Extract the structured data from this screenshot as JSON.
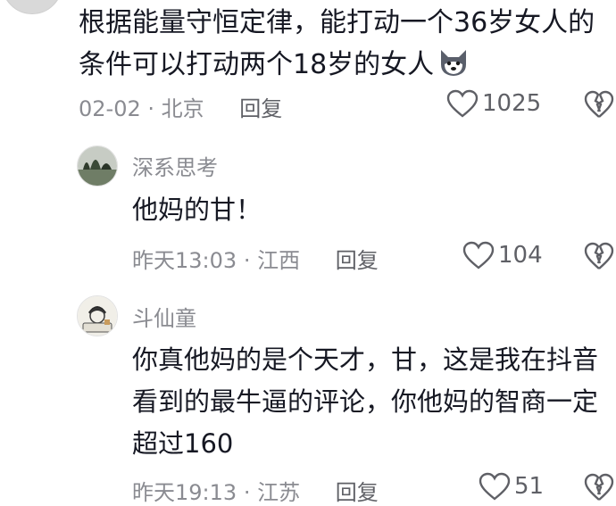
{
  "comment": {
    "text": "根据能量守恒定律，能打动一个36岁女人的条件可以打动两个18岁的女人",
    "date": "02-02",
    "location": "北京",
    "reply_label": "回复",
    "likes": "1025",
    "emoji_icon": "wolf-emoji-icon"
  },
  "replies": [
    {
      "name": "深系思考",
      "text": "他妈的甘！",
      "date": "昨天13:03",
      "location": "江西",
      "reply_label": "回复",
      "likes": "104"
    },
    {
      "name": "斗仙童",
      "text": "你真他妈的是个天才，甘，这是我在抖音看到的最牛逼的评论，你他妈的智商一定超过160",
      "date": "昨天19:13",
      "location": "江苏",
      "reply_label": "回复",
      "likes": "51"
    }
  ],
  "colors": {
    "text": "#161823",
    "meta": "#8a8b91",
    "icon": "#5f6066"
  }
}
